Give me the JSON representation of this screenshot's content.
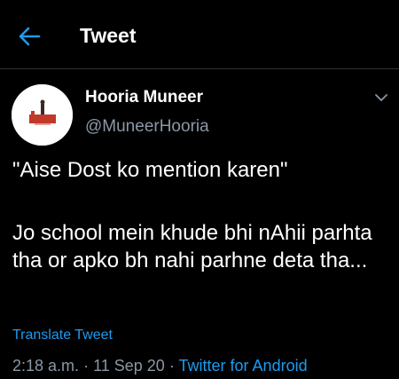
{
  "header": {
    "title": "Tweet",
    "back_icon": "arrow-left-icon",
    "accent_color": "#1d9bf0"
  },
  "tweet": {
    "author": {
      "name": "Hooria Muneer",
      "handle": "@MuneerHooria",
      "avatar_icon": "avatar-image"
    },
    "text_line1": "\"Aise Dost ko mention karen\"",
    "text_line2": "Jo school mein khude bhi nAhii parhta tha or apko bh nahi parhne deta tha...",
    "translate_label": "Translate Tweet",
    "time": "2:18 a.m.",
    "separator": "·",
    "date": "11 Sep 20",
    "source": "Twitter for Android"
  },
  "colors": {
    "background": "#000000",
    "text": "#ffffff",
    "muted": "#8b98a5",
    "link": "#1d9bf0",
    "divider": "#2f3336"
  }
}
